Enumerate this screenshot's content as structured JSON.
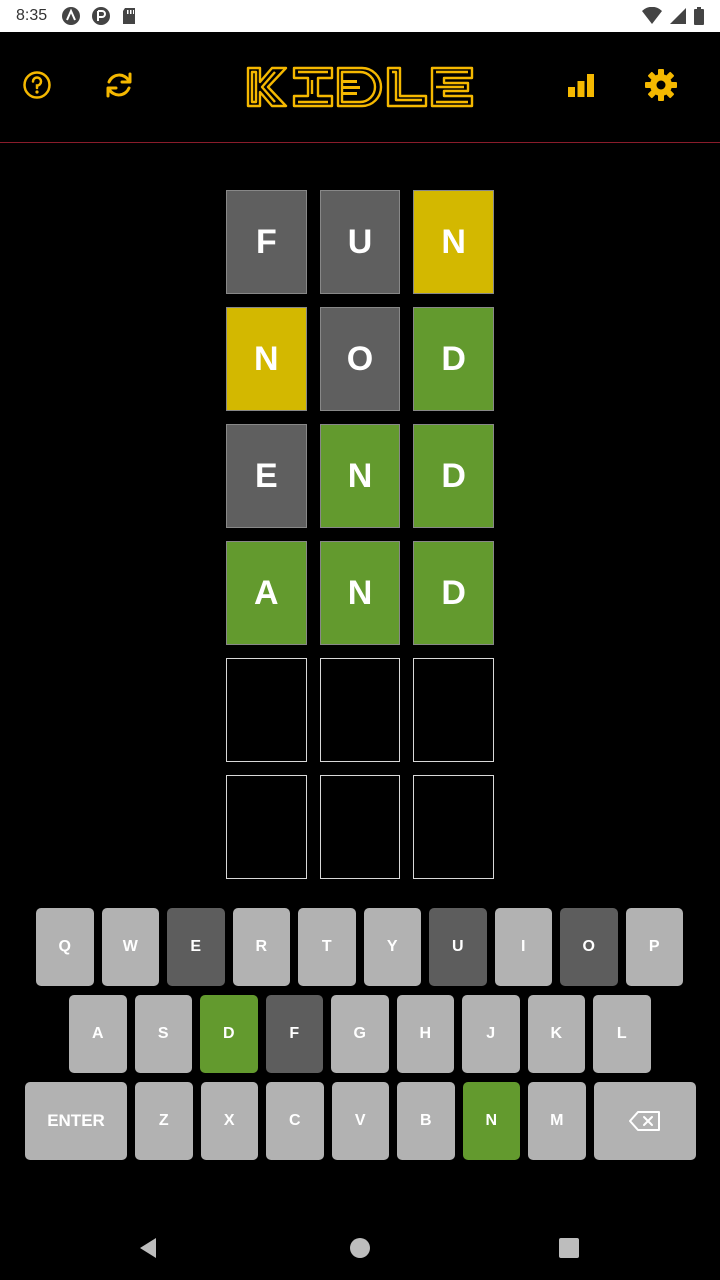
{
  "status_bar": {
    "time": "8:35"
  },
  "header": {
    "logo_alt": "KIDLE"
  },
  "board": {
    "rows": [
      [
        {
          "letter": "F",
          "state": "gray"
        },
        {
          "letter": "U",
          "state": "gray"
        },
        {
          "letter": "N",
          "state": "yellow"
        }
      ],
      [
        {
          "letter": "N",
          "state": "yellow"
        },
        {
          "letter": "O",
          "state": "gray"
        },
        {
          "letter": "D",
          "state": "green"
        }
      ],
      [
        {
          "letter": "E",
          "state": "gray"
        },
        {
          "letter": "N",
          "state": "green"
        },
        {
          "letter": "D",
          "state": "green"
        }
      ],
      [
        {
          "letter": "A",
          "state": "green"
        },
        {
          "letter": "N",
          "state": "green"
        },
        {
          "letter": "D",
          "state": "green"
        }
      ],
      [
        {
          "letter": "",
          "state": "empty"
        },
        {
          "letter": "",
          "state": "empty"
        },
        {
          "letter": "",
          "state": "empty"
        }
      ],
      [
        {
          "letter": "",
          "state": "empty"
        },
        {
          "letter": "",
          "state": "empty"
        },
        {
          "letter": "",
          "state": "empty"
        }
      ]
    ]
  },
  "keyboard": {
    "rows": [
      [
        {
          "label": "Q",
          "state": "default"
        },
        {
          "label": "W",
          "state": "default"
        },
        {
          "label": "E",
          "state": "dark"
        },
        {
          "label": "R",
          "state": "default"
        },
        {
          "label": "T",
          "state": "default"
        },
        {
          "label": "Y",
          "state": "default"
        },
        {
          "label": "U",
          "state": "dark"
        },
        {
          "label": "I",
          "state": "default"
        },
        {
          "label": "O",
          "state": "dark"
        },
        {
          "label": "P",
          "state": "default"
        }
      ],
      [
        {
          "label": "A",
          "state": "default"
        },
        {
          "label": "S",
          "state": "default"
        },
        {
          "label": "D",
          "state": "green"
        },
        {
          "label": "F",
          "state": "dark"
        },
        {
          "label": "G",
          "state": "default"
        },
        {
          "label": "H",
          "state": "default"
        },
        {
          "label": "J",
          "state": "default"
        },
        {
          "label": "K",
          "state": "default"
        },
        {
          "label": "L",
          "state": "default"
        }
      ],
      [
        {
          "label": "ENTER",
          "state": "default",
          "wide": true
        },
        {
          "label": "Z",
          "state": "default"
        },
        {
          "label": "X",
          "state": "default"
        },
        {
          "label": "C",
          "state": "default"
        },
        {
          "label": "V",
          "state": "default"
        },
        {
          "label": "B",
          "state": "default"
        },
        {
          "label": "N",
          "state": "green"
        },
        {
          "label": "M",
          "state": "default"
        },
        {
          "label": "",
          "state": "default",
          "wide": true,
          "icon": "backspace-icon"
        }
      ]
    ]
  },
  "colors": {
    "accent": "#f5b800",
    "gray": "#5f5f5f",
    "yellow": "#d3b800",
    "green": "#639a2e",
    "key": "#b2b2b2",
    "divider": "#8a1c2b"
  }
}
